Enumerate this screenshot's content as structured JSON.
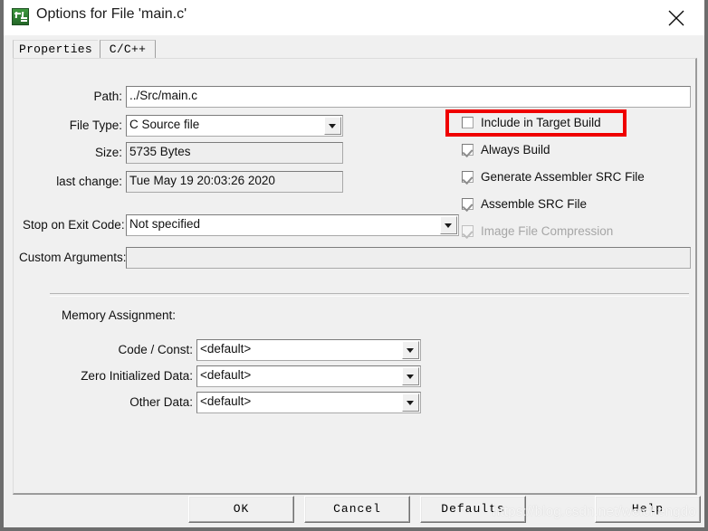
{
  "window": {
    "title": "Options for File 'main.c'",
    "icon": "uvision-app-icon",
    "close_label": "✕"
  },
  "tabs": [
    {
      "label": "Properties",
      "active": true
    },
    {
      "label": "C/C++",
      "active": false
    }
  ],
  "properties": {
    "fields": [
      {
        "label": "Path:",
        "value": "../Src/main.c",
        "type": "text",
        "readonly": false
      },
      {
        "label": "File Type:",
        "value": "C Source file",
        "type": "combo",
        "readonly": false
      },
      {
        "label": "Size:",
        "value": "5735 Bytes",
        "type": "text",
        "readonly": true
      },
      {
        "label": "last change:",
        "value": "Tue May 19 20:03:26 2020",
        "type": "text",
        "readonly": true
      },
      {
        "label": "Stop on Exit Code:",
        "value": "Not specified",
        "type": "combo",
        "readonly": false
      },
      {
        "label": "Custom Arguments:",
        "value": "",
        "type": "text",
        "readonly": false
      }
    ],
    "checkboxes": [
      {
        "label": "Include in Target Build",
        "checked": false,
        "disabled": false,
        "highlighted": true
      },
      {
        "label": "Always Build",
        "checked": true,
        "disabled": false,
        "highlighted": false
      },
      {
        "label": "Generate Assembler SRC File",
        "checked": true,
        "disabled": false,
        "highlighted": false
      },
      {
        "label": "Assemble SRC File",
        "checked": true,
        "disabled": false,
        "highlighted": false
      },
      {
        "label": "Image File Compression",
        "checked": true,
        "disabled": true,
        "highlighted": false
      }
    ],
    "memory_assignment": {
      "section_label": "Memory Assignment:",
      "rows": [
        {
          "label": "Code / Const:",
          "value": "<default>"
        },
        {
          "label": "Zero Initialized Data:",
          "value": "<default>"
        },
        {
          "label": "Other Data:",
          "value": "<default>"
        }
      ]
    }
  },
  "footer": {
    "buttons": [
      {
        "label": "OK"
      },
      {
        "label": "Cancel"
      },
      {
        "label": "Defaults"
      },
      {
        "label": "Help"
      }
    ]
  },
  "annotation": {
    "highlight_color": "#ef0000",
    "watermark": "https://blog.csdn.net/weichengdo"
  }
}
